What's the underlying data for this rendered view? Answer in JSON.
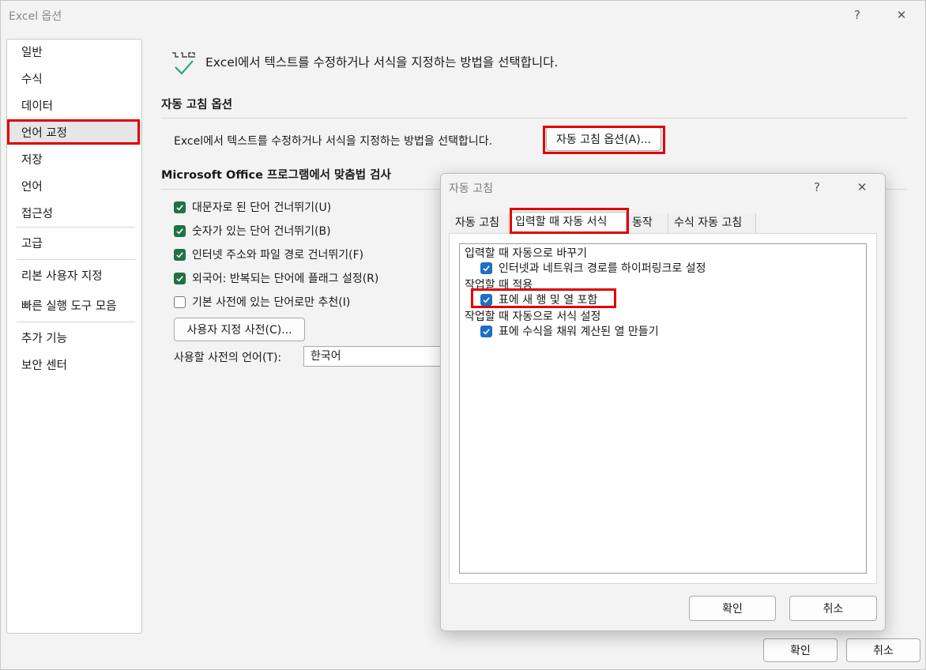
{
  "window": {
    "title": "Excel 옵션",
    "help": "?",
    "close": "✕"
  },
  "nav": {
    "items": [
      "일반",
      "수식",
      "데이터",
      "언어 교정",
      "저장",
      "언어",
      "접근성",
      "고급",
      "리본 사용자 지정",
      "빠른 실행 도구 모음",
      "추가 기능",
      "보안 센터"
    ],
    "selected": "언어 교정"
  },
  "content": {
    "header": "Excel에서 텍스트를 수정하거나 서식을 지정하는 방법을 선택합니다.",
    "autocorrect_section": {
      "title": "자동 고침 옵션",
      "description": "Excel에서 텍스트를 수정하거나 서식을 지정하는 방법을 선택합니다.",
      "button": "자동 고침 옵션(A)..."
    },
    "spelling_section": {
      "title": "Microsoft Office 프로그램에서 맞춤법 검사",
      "options": [
        {
          "label": "대문자로 된 단어 건너뛰기(U)",
          "checked": true
        },
        {
          "label": "숫자가 있는 단어 건너뛰기(B)",
          "checked": true
        },
        {
          "label": "인터넷 주소와 파일 경로 건너뛰기(F)",
          "checked": true
        },
        {
          "label": "외국어: 반복되는 단어에 플래그 설정(R)",
          "checked": true
        },
        {
          "label": "기본 사전에 있는 단어로만 추천(I)",
          "checked": false
        }
      ],
      "custom_dict_button": "사용자 지정 사전(C)...",
      "dict_lang_label": "사용할 사전의 언어(T):",
      "dict_lang_value": "한국어"
    }
  },
  "dialog": {
    "title": "자동 고침",
    "help": "?",
    "close": "✕",
    "tabs": [
      "자동 고침",
      "입력할 때 자동 서식",
      "동작",
      "수식 자동 고침"
    ],
    "active_tab": "입력할 때 자동 서식",
    "groups": [
      {
        "title": "입력할 때 자동으로 바꾸기",
        "items": [
          {
            "label": "인터넷과 네트워크 경로를 하이퍼링크로 설정",
            "checked": true
          }
        ]
      },
      {
        "title": "작업할 때 적용",
        "items": [
          {
            "label": "표에 새 행 및 열 포함",
            "checked": true
          }
        ]
      },
      {
        "title": "작업할 때 자동으로 서식 설정",
        "items": [
          {
            "label": "표에 수식을 채워 계산된 열 만들기",
            "checked": true
          }
        ]
      }
    ],
    "ok": "확인",
    "cancel": "취소"
  },
  "footer": {
    "ok": "확인",
    "cancel": "취소"
  },
  "colors": {
    "highlight_red": "#e00000",
    "check_green": "#1f7244",
    "check_blue": "#1c6fc4"
  }
}
